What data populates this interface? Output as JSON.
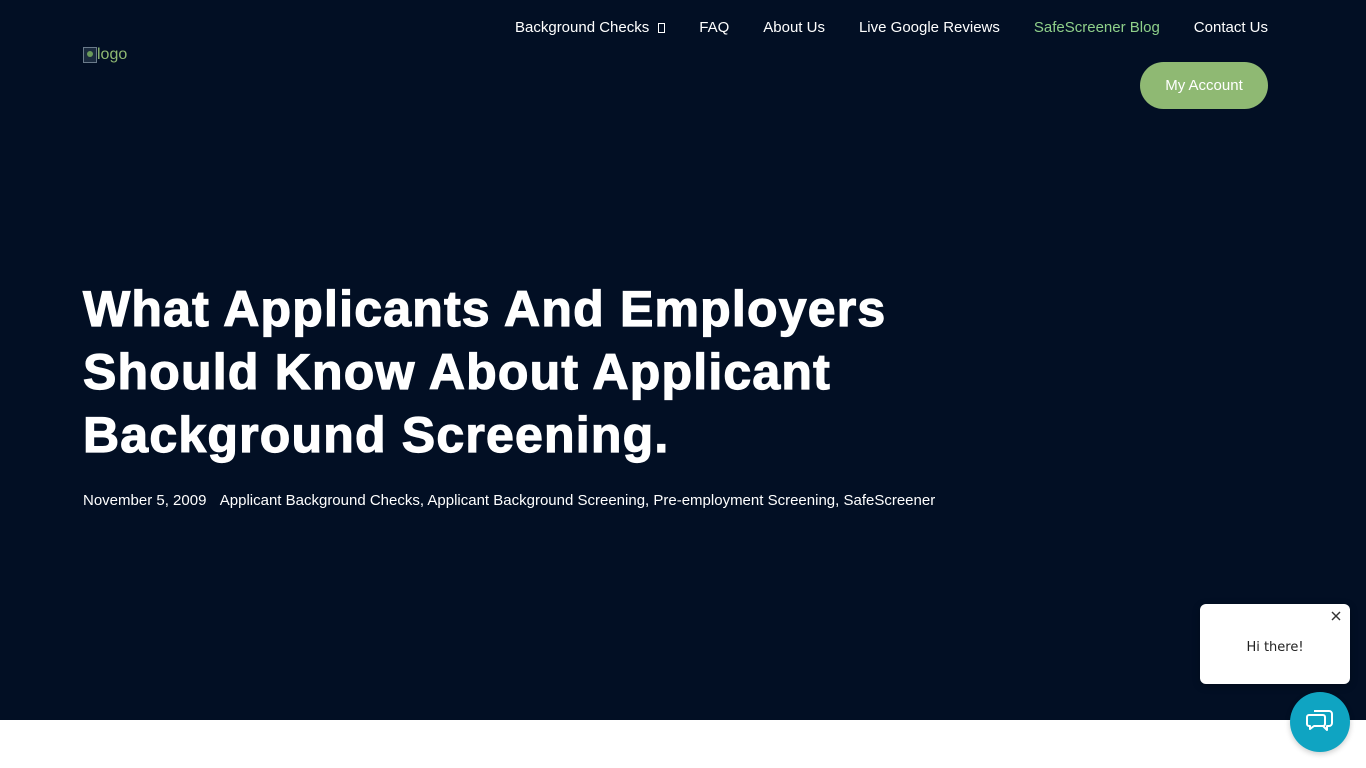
{
  "logo": {
    "alt": "logo"
  },
  "nav": {
    "items": [
      {
        "label": "Background Checks",
        "has_dropdown": true,
        "active": false
      },
      {
        "label": "FAQ",
        "active": false
      },
      {
        "label": "About Us",
        "active": false
      },
      {
        "label": "Live Google Reviews",
        "active": false
      },
      {
        "label": "SafeScreener Blog",
        "active": true
      },
      {
        "label": "Contact Us",
        "active": false
      }
    ],
    "account_label": "My Account"
  },
  "post": {
    "title": "What Applicants And Employers Should Know About Applicant Background Screening.",
    "date": "November 5, 2009",
    "categories": [
      "Applicant Background Checks",
      "Applicant Background Screening",
      "Pre-employment Screening",
      "SafeScreener"
    ]
  },
  "chat": {
    "greeting": "Hi there!",
    "close_icon": "close-icon",
    "launcher_icon": "chat-icon"
  },
  "colors": {
    "hero_bg": "#020f24",
    "accent_green": "#8fb973",
    "active_nav": "#8fd08a",
    "chat_launcher": "#0fa4c2"
  }
}
